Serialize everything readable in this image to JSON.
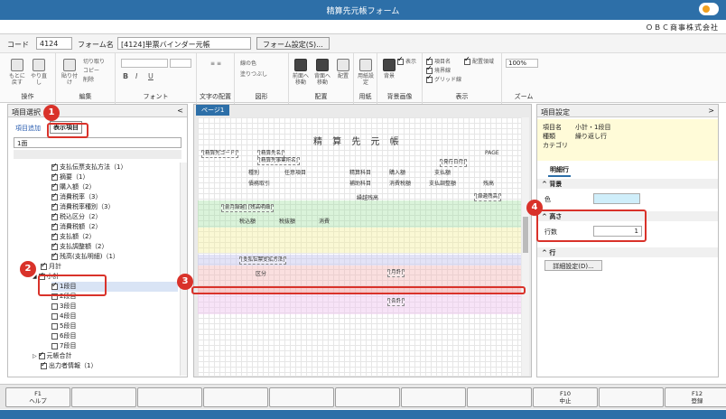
{
  "window": {
    "title": "精算先元帳フォーム",
    "company_logo": "OBC",
    "company_name": "ＯＢＣ商事株式会社"
  },
  "form": {
    "code_label": "コード",
    "code_value": "4124",
    "name_label": "フォーム名",
    "name_value": "[4124]単票バインダー元帳",
    "settings_button": "フォーム設定(S)..."
  },
  "ribbon": {
    "operation": {
      "label": "操作",
      "undo": "もとに戻す",
      "redo": "やり直し"
    },
    "edit": {
      "label": "編集",
      "paste": "貼り付け",
      "cut": "切り取り",
      "copy": "コピー",
      "delete": "削除"
    },
    "font": {
      "label": "フォント",
      "bold": "B",
      "italic": "I",
      "underline": "U"
    },
    "text_layout": {
      "label": "文字の配置"
    },
    "shapes": {
      "label": "図形",
      "line_color": "線の色",
      "fill": "塗りつぶし"
    },
    "layout": {
      "label": "配置",
      "front": "前面へ移動",
      "back": "背面へ移動",
      "align": "配置"
    },
    "paper": {
      "label": "用紙",
      "paper_settings": "用紙設定"
    },
    "background": {
      "label": "背景画像",
      "background": "背景",
      "show": "表示"
    },
    "display": {
      "label": "表示",
      "item_name": "項目名",
      "placement_area": "配置領域",
      "border": "境界線",
      "grid": "グリッド線"
    },
    "zoom": {
      "label": "ズーム",
      "value": "100%"
    }
  },
  "left_panel": {
    "title": "項目選択",
    "tab_add": "項目追加",
    "tab_show": "表示項目",
    "page_select": "1面",
    "tree": [
      {
        "label": "支払伝票支払方法（1）",
        "checked": true,
        "indent": 1
      },
      {
        "label": "摘要（1）",
        "checked": true,
        "indent": 1
      },
      {
        "label": "購入額（2）",
        "checked": true,
        "indent": 1
      },
      {
        "label": "消費税率（3）",
        "checked": true,
        "indent": 1
      },
      {
        "label": "消費税率種別（3）",
        "checked": true,
        "indent": 1
      },
      {
        "label": "税込区分（2）",
        "checked": true,
        "indent": 1
      },
      {
        "label": "消費税額（2）",
        "checked": true,
        "indent": 1
      },
      {
        "label": "支払額（2）",
        "checked": true,
        "indent": 1
      },
      {
        "label": "支払調整額（2）",
        "checked": true,
        "indent": 1
      },
      {
        "label": "残高(支払明細)（1）",
        "checked": true,
        "indent": 1
      },
      {
        "label": "月計",
        "checked": true,
        "indent": 0
      },
      {
        "label": "小計",
        "checked": true,
        "indent": 0,
        "expanded": true
      },
      {
        "label": "1段目",
        "checked": true,
        "indent": 1,
        "selected": true
      },
      {
        "label": "2段目",
        "checked": false,
        "indent": 1
      },
      {
        "label": "3段目",
        "checked": false,
        "indent": 1
      },
      {
        "label": "4段目",
        "checked": false,
        "indent": 1
      },
      {
        "label": "5段目",
        "checked": false,
        "indent": 1
      },
      {
        "label": "6段目",
        "checked": false,
        "indent": 1
      },
      {
        "label": "7段目",
        "checked": false,
        "indent": 1
      },
      {
        "label": "元帳合計",
        "checked": true,
        "indent": 0,
        "collapsed": true
      },
      {
        "label": "出力者情報（1）",
        "checked": true,
        "indent": 0
      }
    ]
  },
  "center_panel": {
    "page_tab": "ページ1",
    "sheet": {
      "title": "精 算 先 元 帳",
      "hdr_code": "[精算先コード]",
      "hdr_name": "[精算先名]",
      "hdr_biz": "[精算先事業所名]",
      "hdr_page": "PAGE",
      "hdr_date": "[発行日付]",
      "col_kind": "種別",
      "col_item": "任意項目",
      "col_settle": "精算科目",
      "col_purchase": "購入額",
      "col_pay": "支払額",
      "col_balance": "残高",
      "col_partner": "債務取引",
      "col_aux": "補助科目",
      "col_tax": "消費税額",
      "col_adjust": "支払調整額",
      "carry": "繰越残高",
      "carry_amount": "[繰越残高]",
      "row1": "[前月繰越] [残高明細]",
      "tax_incl": "税込額",
      "tax_excl": "税抜額",
      "tax": "消費",
      "payment": "[支払伝票支払方法]",
      "kubun": "区分",
      "monthly": "[月計]",
      "subtotal": "[小計]",
      "summary": "[合計]"
    }
  },
  "right_panel": {
    "title": "項目設定",
    "item_name_label": "項目名",
    "item_name_value": "小計・1段目",
    "type_label": "種類",
    "type_value": "繰り返し行",
    "category_label": "カテゴリ",
    "category_value": "",
    "tab": "明細行",
    "bg_section": "背景",
    "color_label": "色",
    "color_value": "#cfeefa",
    "height_section": "高さ",
    "rows_label": "行数",
    "rows_value": "1",
    "row_section": "行",
    "detail_button": "詳細設定(D)..."
  },
  "callouts": [
    "1",
    "2",
    "3",
    "4"
  ],
  "fkeys": [
    {
      "key": "F1",
      "label": "ヘルプ"
    },
    {
      "key": "",
      "label": ""
    },
    {
      "key": "",
      "label": ""
    },
    {
      "key": "",
      "label": ""
    },
    {
      "key": "",
      "label": ""
    },
    {
      "key": "",
      "label": ""
    },
    {
      "key": "",
      "label": ""
    },
    {
      "key": "",
      "label": ""
    },
    {
      "key": "F10",
      "label": "中止"
    },
    {
      "key": "",
      "label": ""
    },
    {
      "key": "F12",
      "label": "登録"
    }
  ]
}
